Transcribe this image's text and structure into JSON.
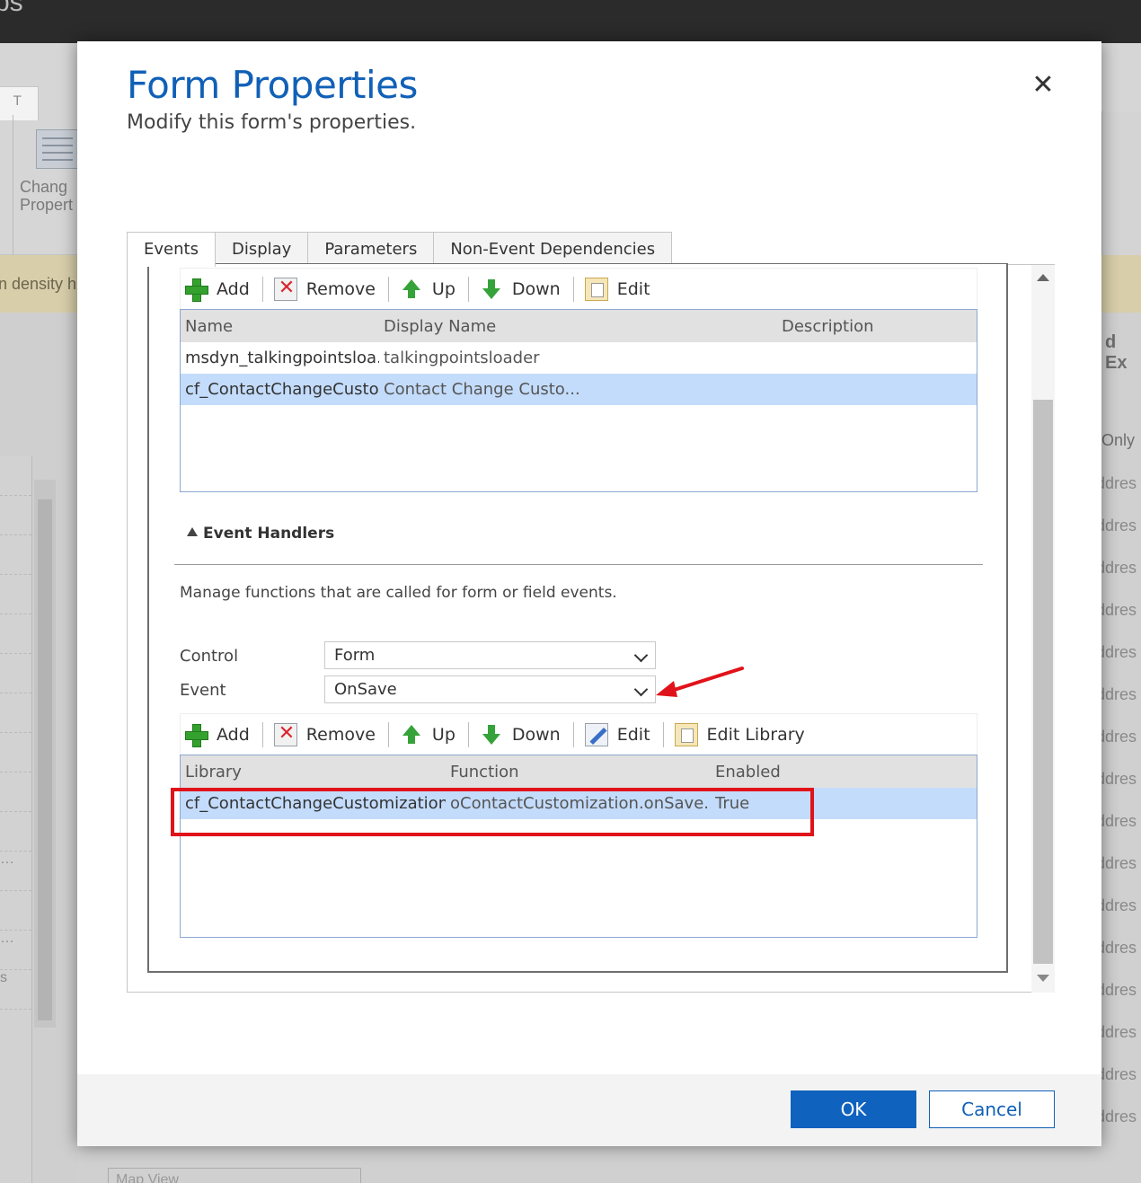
{
  "background": {
    "app_title_fragment": "ps",
    "ribbon_tab_fragment": "T",
    "ribbon_button_label_1": "Chang",
    "ribbon_button_label_2": "Propert",
    "banner_text_fragment": "n density h",
    "right_header_fragment": "d Ex",
    "right_only_fragment": "Only",
    "right_rows": [
      "ddres",
      "ddres",
      "ddres",
      "ddres",
      "ddres",
      "ddres",
      "ddres",
      "ddres",
      "ddres",
      "ddres",
      "ddres",
      "ddres",
      "ddres",
      "ddres",
      "ddres",
      "ddres"
    ],
    "left_rows": [
      "",
      "",
      "",
      "",
      "",
      "",
      "",
      "",
      "",
      "",
      "…",
      "",
      "…",
      "s"
    ],
    "bottom_field": "Map View"
  },
  "dialog": {
    "title": "Form Properties",
    "subtitle": "Modify this form's properties.",
    "close_glyph": "✕",
    "tabs": [
      {
        "label": "Events"
      },
      {
        "label": "Display"
      },
      {
        "label": "Parameters"
      },
      {
        "label": "Non-Event Dependencies"
      }
    ],
    "libraries_toolbar": {
      "add": "Add",
      "remove": "Remove",
      "up": "Up",
      "down": "Down",
      "edit": "Edit"
    },
    "libraries_grid": {
      "columns": [
        "Name",
        "Display Name",
        "Description"
      ],
      "rows": [
        {
          "name": "msdyn_talkingpointsloa...",
          "display_name": "talkingpointsloader",
          "description": ""
        },
        {
          "name": "cf_ContactChangeCusto...",
          "display_name": "Contact Change Custo...",
          "description": ""
        }
      ]
    },
    "event_handlers": {
      "heading": "Event Handlers",
      "description": "Manage functions that are called for form or field events.",
      "control_label": "Control",
      "control_value": "Form",
      "event_label": "Event",
      "event_value": "OnSave"
    },
    "handlers_toolbar": {
      "add": "Add",
      "remove": "Remove",
      "up": "Up",
      "down": "Down",
      "edit": "Edit",
      "edit_library": "Edit Library"
    },
    "handlers_grid": {
      "columns": [
        "Library",
        "Function",
        "Enabled"
      ],
      "rows": [
        {
          "library": "cf_ContactChangeCustomization",
          "function": "oContactCustomization.onSave...",
          "enabled": "True"
        }
      ]
    },
    "footer": {
      "ok": "OK",
      "cancel": "Cancel"
    }
  },
  "colors": {
    "accent": "#1160b7",
    "primary_button": "#0f62bd",
    "selection": "#c4dcfb",
    "annotation": "#e0131a"
  }
}
